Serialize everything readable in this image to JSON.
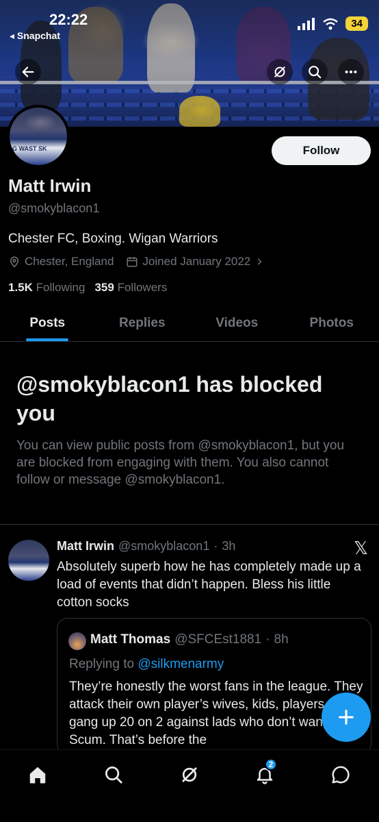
{
  "status_bar": {
    "time": "22:22",
    "back_app": "◂ Snapchat",
    "battery": "34"
  },
  "profile": {
    "name": "Matt Irwin",
    "handle": "@smokyblacon1",
    "bio": "Chester FC, Boxing. Wigan Warriors",
    "location": "Chester, England",
    "joined": "Joined January 2022",
    "following_count": "1.5K",
    "following_label": "Following",
    "followers_count": "359",
    "followers_label": "Followers",
    "follow_label": "Follow",
    "avatar_text": "G WAST SK"
  },
  "tabs": [
    {
      "label": "Posts"
    },
    {
      "label": "Replies"
    },
    {
      "label": "Videos"
    },
    {
      "label": "Photos"
    }
  ],
  "blocked": {
    "title": "@smokyblacon1 has blocked you",
    "text": "You can view public posts from @smokyblacon1, but you are blocked from engaging with them. You also cannot follow or message @smokyblacon1."
  },
  "tweet": {
    "name": "Matt Irwin",
    "handle": "@smokyblacon1",
    "sep": "·",
    "time": "3h",
    "body": "Absolutely superb how he has completely made up a load of events that didn’t happen. Bless his little cotton socks",
    "quote": {
      "name": "Matt Thomas",
      "handle": "@SFCEst1881",
      "sep": "·",
      "time": "8h",
      "replying_label": "Replying to",
      "replying_to": "@silkmenarmy",
      "body": "They’re honestly the worst fans in the league. They attack their own player’s wives, kids, players. They gang up 20 on 2 against lads who don’t want it. Scum. That’s before the"
    }
  },
  "bottom_nav": {
    "notifications_badge": "2"
  },
  "icons": {
    "back": "arrow-left-icon",
    "grok": "grok-icon",
    "search": "search-icon",
    "more": "more-icon",
    "location": "location-pin-icon",
    "calendar": "calendar-icon",
    "chevron": "chevron-right-icon",
    "x_logo": "x-logo-icon",
    "compose": "plus-icon",
    "home": "home-icon",
    "notifications": "bell-icon",
    "messages": "message-icon"
  },
  "colors": {
    "accent": "#1d9bf0",
    "background": "#000000",
    "text": "#e7e9ea",
    "muted": "#71767b",
    "battery": "#f3d23a"
  }
}
